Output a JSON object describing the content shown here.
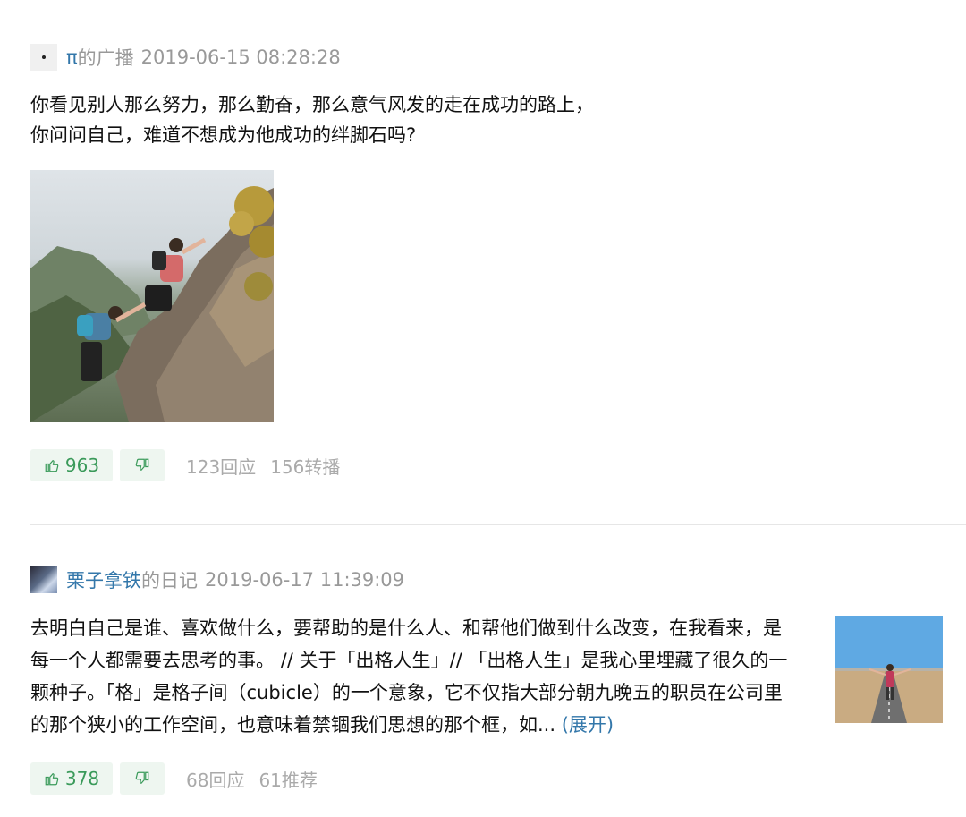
{
  "posts": [
    {
      "author": "π",
      "kind": "的广播",
      "time": "2019-06-15 08:28:28",
      "text_lines": [
        "你看见别人那么努力，那么勤奋，那么意气风发的走在成功的路上，",
        "你问问自己，难道不想成为他成功的绊脚石吗?"
      ],
      "image": "photo-two-hikers-climbing-rock",
      "likes": "963",
      "replies": "123回应",
      "shares": "156转播"
    },
    {
      "author": "栗子拿铁",
      "kind": "的日记",
      "time": "2019-06-17 11:39:09",
      "text": "去明白自己是谁、喜欢做什么，要帮助的是什么人、和帮他们做到什么改变，在我看来，是每一个人都需要去思考的事。 // 关于「出格人生」// 「出格人生」是我心里埋藏了很久的一颗种子。「格」是格子间（cubicle）的一个意象，它不仅指大部分朝九晚五的职员在公司里的那个狭小的工作空间，也意味着禁锢我们思想的那个框，如...",
      "expand": "(展开)",
      "image": "photo-woman-on-desert-road",
      "likes": "378",
      "replies": "68回应",
      "recommends": "61推荐"
    }
  ],
  "colors": {
    "link": "#3377aa",
    "meta": "#999999",
    "like_bg": "#eef6f0",
    "like_text": "#3a9a5a"
  },
  "icons": {
    "like": "thumbs-up-icon",
    "dislike": "thumbs-down-icon"
  }
}
